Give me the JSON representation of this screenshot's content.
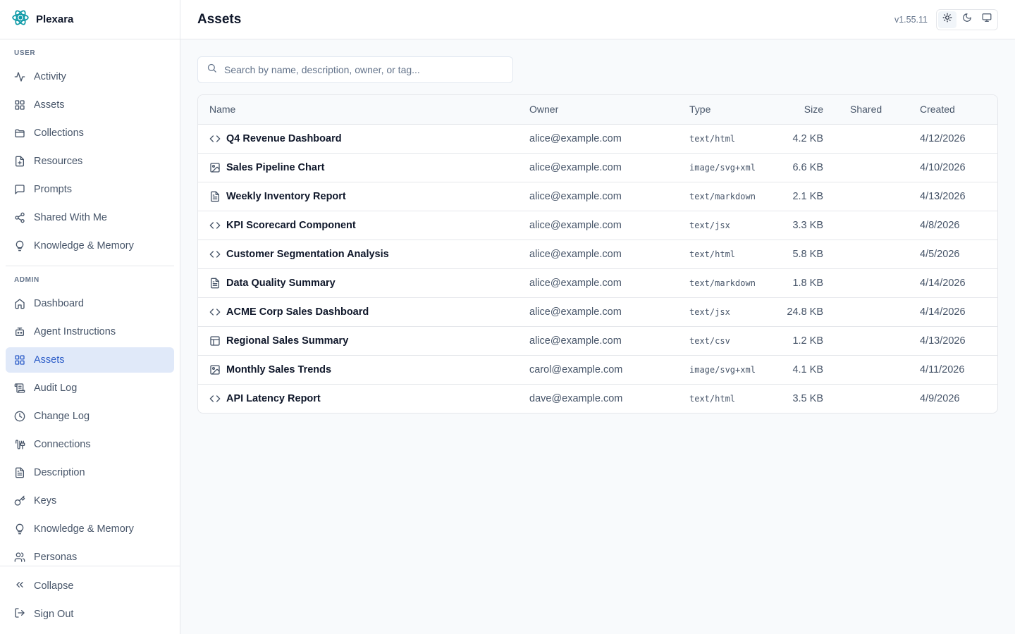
{
  "app": {
    "name": "Plexara"
  },
  "sidebar": {
    "user_label": "USER",
    "user_items": [
      {
        "label": "Activity",
        "icon": "activity-icon"
      },
      {
        "label": "Assets",
        "icon": "grid-icon"
      },
      {
        "label": "Collections",
        "icon": "folder-icon"
      },
      {
        "label": "Resources",
        "icon": "file-plus-icon"
      },
      {
        "label": "Prompts",
        "icon": "message-icon"
      },
      {
        "label": "Shared With Me",
        "icon": "share-icon"
      },
      {
        "label": "Knowledge & Memory",
        "icon": "lightbulb-icon"
      }
    ],
    "admin_label": "ADMIN",
    "admin_items": [
      {
        "label": "Dashboard",
        "icon": "home-icon"
      },
      {
        "label": "Agent Instructions",
        "icon": "bot-icon"
      },
      {
        "label": "Assets",
        "icon": "grid-icon",
        "active": true
      },
      {
        "label": "Audit Log",
        "icon": "scroll-icon"
      },
      {
        "label": "Change Log",
        "icon": "clock-icon"
      },
      {
        "label": "Connections",
        "icon": "cable-icon"
      },
      {
        "label": "Description",
        "icon": "file-text-icon"
      },
      {
        "label": "Keys",
        "icon": "key-icon"
      },
      {
        "label": "Knowledge & Memory",
        "icon": "lightbulb-icon"
      },
      {
        "label": "Personas",
        "icon": "users-icon"
      }
    ],
    "footer": {
      "collapse_label": "Collapse",
      "signout_label": "Sign Out"
    }
  },
  "header": {
    "title": "Assets",
    "version": "v1.55.11"
  },
  "search": {
    "placeholder": "Search by name, description, owner, or tag..."
  },
  "table": {
    "columns": {
      "name": "Name",
      "owner": "Owner",
      "type": "Type",
      "size": "Size",
      "shared": "Shared",
      "created": "Created"
    },
    "rows": [
      {
        "icon": "code-icon",
        "name": "Q4 Revenue Dashboard",
        "owner": "alice@example.com",
        "type": "text/html",
        "size": "4.2 KB",
        "shared": "",
        "created": "4/12/2026"
      },
      {
        "icon": "image-icon",
        "name": "Sales Pipeline Chart",
        "owner": "alice@example.com",
        "type": "image/svg+xml",
        "size": "6.6 KB",
        "shared": "",
        "created": "4/10/2026"
      },
      {
        "icon": "file-text-icon",
        "name": "Weekly Inventory Report",
        "owner": "alice@example.com",
        "type": "text/markdown",
        "size": "2.1 KB",
        "shared": "",
        "created": "4/13/2026"
      },
      {
        "icon": "code-icon",
        "name": "KPI Scorecard Component",
        "owner": "alice@example.com",
        "type": "text/jsx",
        "size": "3.3 KB",
        "shared": "",
        "created": "4/8/2026"
      },
      {
        "icon": "code-icon",
        "name": "Customer Segmentation Analysis",
        "owner": "alice@example.com",
        "type": "text/html",
        "size": "5.8 KB",
        "shared": "",
        "created": "4/5/2026"
      },
      {
        "icon": "file-text-icon",
        "name": "Data Quality Summary",
        "owner": "alice@example.com",
        "type": "text/markdown",
        "size": "1.8 KB",
        "shared": "",
        "created": "4/14/2026"
      },
      {
        "icon": "code-icon",
        "name": "ACME Corp Sales Dashboard",
        "owner": "alice@example.com",
        "type": "text/jsx",
        "size": "24.8 KB",
        "shared": "",
        "created": "4/14/2026"
      },
      {
        "icon": "table-icon",
        "name": "Regional Sales Summary",
        "owner": "alice@example.com",
        "type": "text/csv",
        "size": "1.2 KB",
        "shared": "",
        "created": "4/13/2026"
      },
      {
        "icon": "image-icon",
        "name": "Monthly Sales Trends",
        "owner": "carol@example.com",
        "type": "image/svg+xml",
        "size": "4.1 KB",
        "shared": "",
        "created": "4/11/2026"
      },
      {
        "icon": "code-icon",
        "name": "API Latency Report",
        "owner": "dave@example.com",
        "type": "text/html",
        "size": "3.5 KB",
        "shared": "",
        "created": "4/9/2026"
      }
    ]
  },
  "colors": {
    "accent": "#2f5fc9",
    "active_bg": "#e0e9f9",
    "logo": "#0e9aa7"
  }
}
